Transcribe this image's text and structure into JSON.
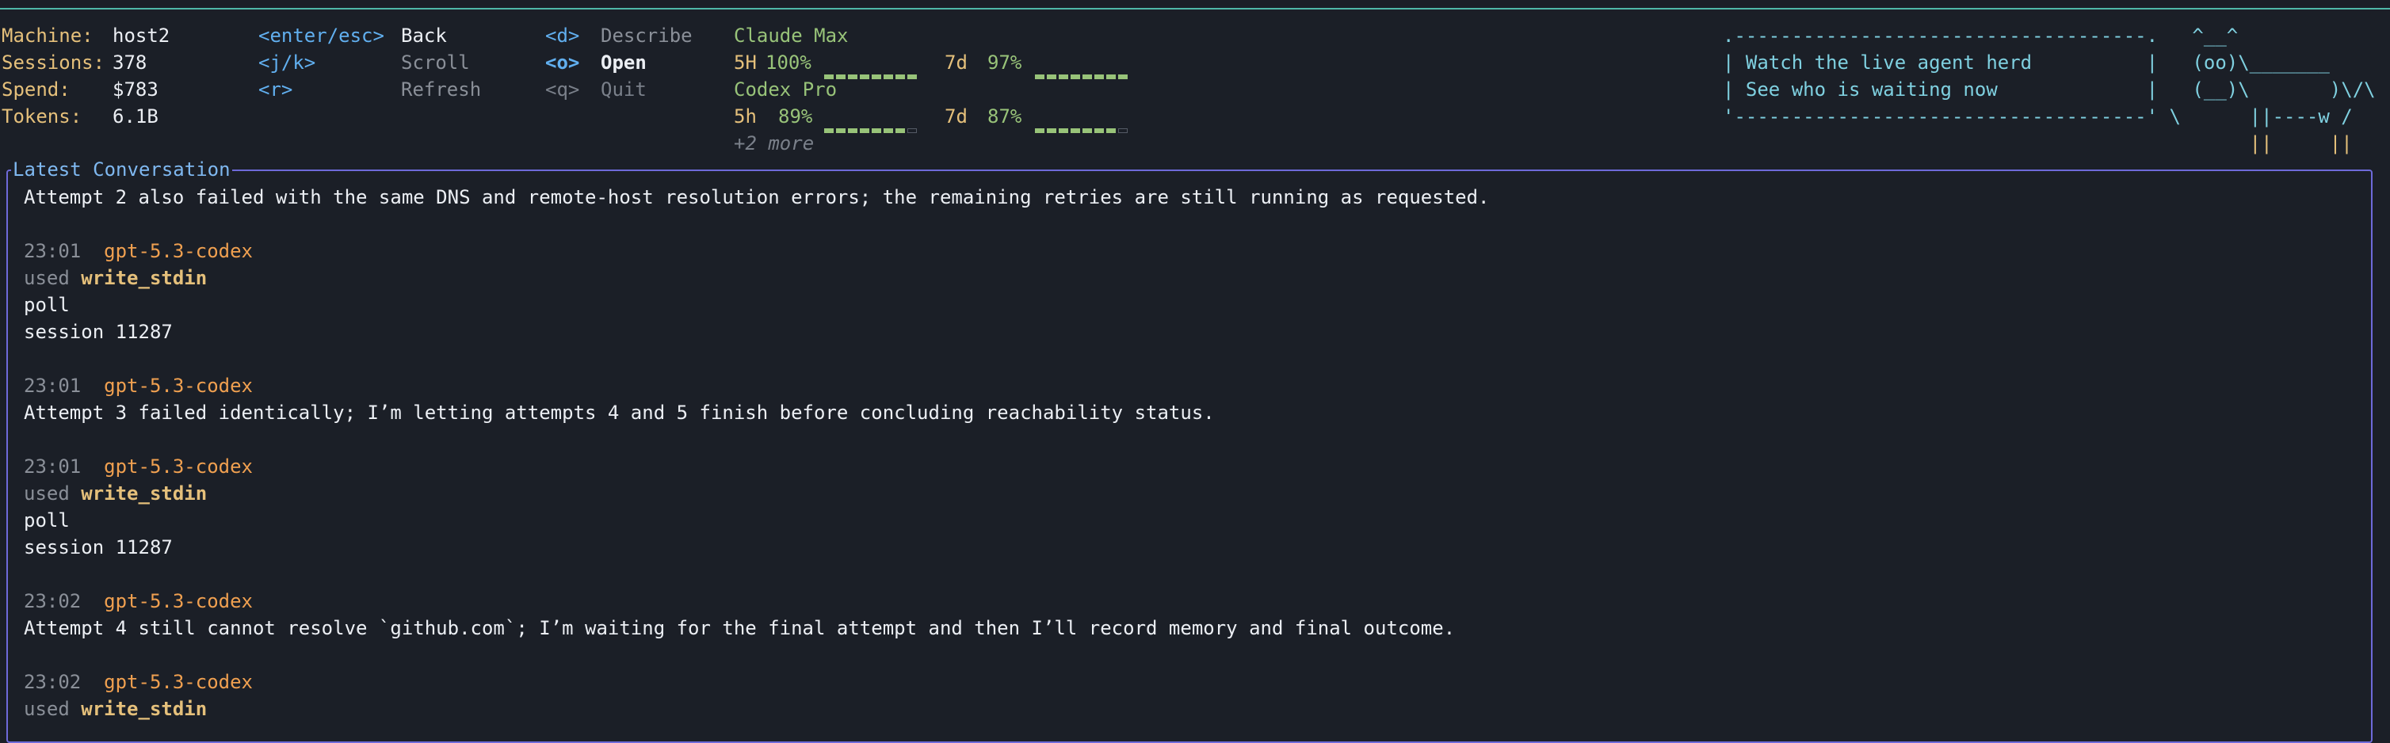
{
  "header": {
    "stats": [
      {
        "label": "Machine:",
        "value": "host2"
      },
      {
        "label": "Sessions:",
        "value": "378"
      },
      {
        "label": "Spend:",
        "value": "$783"
      },
      {
        "label": "Tokens:",
        "value": "6.1B"
      }
    ],
    "keys": [
      {
        "key": "<enter/esc>",
        "action": "Back"
      },
      {
        "key": "<j/k>",
        "action": "Scroll"
      },
      {
        "key": "<r>",
        "action": "Refresh"
      }
    ],
    "keys2": [
      {
        "key": "<d>",
        "action": "Describe"
      },
      {
        "key": "<o>",
        "action": "Open"
      },
      {
        "key": "<q>",
        "action": "Quit"
      }
    ],
    "usage": {
      "plan1": "Claude Max",
      "plan1_5h_label": "5H",
      "plan1_5h_pct": "100%",
      "plan1_5h_fill": 1.0,
      "plan1_7d_label": "7d",
      "plan1_7d_pct": "97%",
      "plan1_7d_fill": 0.97,
      "plan2": "Codex Pro",
      "plan2_5h_label": "5h",
      "plan2_5h_pct": "89%",
      "plan2_5h_fill": 0.89,
      "plan2_7d_label": "7d",
      "plan2_7d_pct": "87%",
      "plan2_7d_fill": 0.87,
      "more": "+2 more"
    },
    "banner": {
      "line0": ".------------------------------------.   ^__^",
      "line1": "| Watch the live agent herd          |   (oo)\\_______",
      "line2": "| See who is waiting now             |   (__)\\       )\\/\\",
      "line3": "'------------------------------------' \\      ||----w /",
      "line4": "                                              ||     ||"
    }
  },
  "panel": {
    "title": "Latest Conversation",
    "intro": "Attempt 2 also failed with the same DNS and remote-host resolution errors; the remaining retries are still running as requested.",
    "entries": [
      {
        "time": "23:01",
        "model": "gpt-5.3-codex",
        "used": "used",
        "tool": "write_stdin",
        "lines": [
          "poll",
          "session 11287"
        ]
      },
      {
        "time": "23:01",
        "model": "gpt-5.3-codex",
        "text": "Attempt 3 failed identically; I’m letting attempts 4 and 5 finish before concluding reachability status."
      },
      {
        "time": "23:01",
        "model": "gpt-5.3-codex",
        "used": "used",
        "tool": "write_stdin",
        "lines": [
          "poll",
          "session 11287"
        ]
      },
      {
        "time": "23:02",
        "model": "gpt-5.3-codex",
        "text": "Attempt 4 still cannot resolve `github.com`; I’m waiting for the final attempt and then I’ll record memory and final outcome."
      },
      {
        "time": "23:02",
        "model": "gpt-5.3-codex",
        "used": "used",
        "tool": "write_stdin"
      }
    ]
  },
  "colors": {
    "background": "#1b1f27",
    "accent_border": "#6e6ad9",
    "top_rule": "#4fb8a8",
    "label_yellow": "#e5c07b",
    "model_orange": "#f0a050",
    "key_blue": "#61afef",
    "usage_green": "#98c379"
  }
}
